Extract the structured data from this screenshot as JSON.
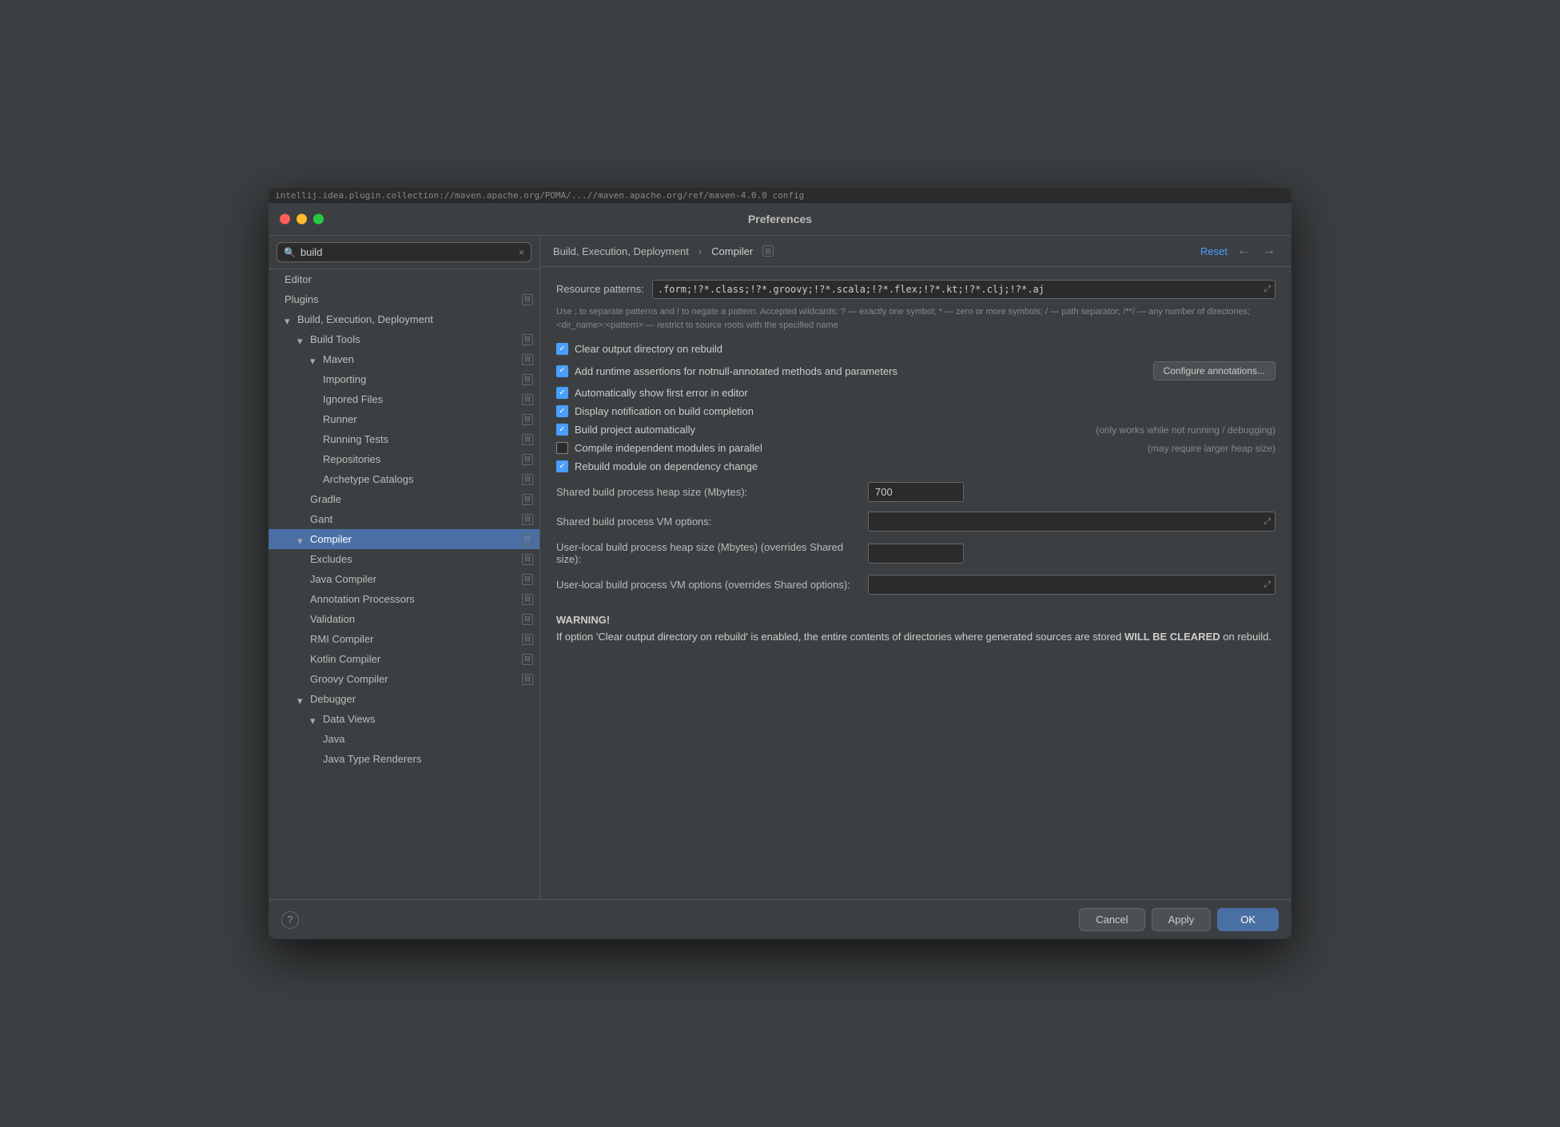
{
  "dialog": {
    "title": "Preferences",
    "url_bar": "intellij.idea.plugin.collection://maven.apache.org/POMA/...//maven.apache.org/ref/maven-4.0.0 config"
  },
  "traffic_lights": {
    "close": "close",
    "minimize": "minimize",
    "maximize": "maximize"
  },
  "sidebar": {
    "search_placeholder": "build",
    "search_value": "build",
    "clear_icon": "×",
    "items": [
      {
        "id": "editor",
        "label": "Editor",
        "indent": 0,
        "arrow": null,
        "badge": false
      },
      {
        "id": "plugins",
        "label": "Plugins",
        "indent": 0,
        "arrow": null,
        "badge": true
      },
      {
        "id": "build-execution-deployment",
        "label": "Build, Execution, Deployment",
        "indent": 0,
        "arrow": "down",
        "badge": false
      },
      {
        "id": "build-tools",
        "label": "Build Tools",
        "indent": 1,
        "arrow": "down",
        "badge": true
      },
      {
        "id": "maven",
        "label": "Maven",
        "indent": 2,
        "arrow": "down",
        "badge": true
      },
      {
        "id": "importing",
        "label": "Importing",
        "indent": 3,
        "arrow": null,
        "badge": true
      },
      {
        "id": "ignored-files",
        "label": "Ignored Files",
        "indent": 3,
        "arrow": null,
        "badge": true
      },
      {
        "id": "runner",
        "label": "Runner",
        "indent": 3,
        "arrow": null,
        "badge": true
      },
      {
        "id": "running-tests",
        "label": "Running Tests",
        "indent": 3,
        "arrow": null,
        "badge": true
      },
      {
        "id": "repositories",
        "label": "Repositories",
        "indent": 3,
        "arrow": null,
        "badge": true
      },
      {
        "id": "archetype-catalogs",
        "label": "Archetype Catalogs",
        "indent": 3,
        "arrow": null,
        "badge": true
      },
      {
        "id": "gradle",
        "label": "Gradle",
        "indent": 2,
        "arrow": null,
        "badge": true
      },
      {
        "id": "gant",
        "label": "Gant",
        "indent": 2,
        "arrow": null,
        "badge": true
      },
      {
        "id": "compiler",
        "label": "Compiler",
        "indent": 1,
        "arrow": "down",
        "badge": true,
        "selected": true
      },
      {
        "id": "excludes",
        "label": "Excludes",
        "indent": 2,
        "arrow": null,
        "badge": true
      },
      {
        "id": "java-compiler",
        "label": "Java Compiler",
        "indent": 2,
        "arrow": null,
        "badge": true
      },
      {
        "id": "annotation-processors",
        "label": "Annotation Processors",
        "indent": 2,
        "arrow": null,
        "badge": true
      },
      {
        "id": "validation",
        "label": "Validation",
        "indent": 2,
        "arrow": null,
        "badge": true
      },
      {
        "id": "rmi-compiler",
        "label": "RMI Compiler",
        "indent": 2,
        "arrow": null,
        "badge": true
      },
      {
        "id": "kotlin-compiler",
        "label": "Kotlin Compiler",
        "indent": 2,
        "arrow": null,
        "badge": true
      },
      {
        "id": "groovy-compiler",
        "label": "Groovy Compiler",
        "indent": 2,
        "arrow": null,
        "badge": true
      },
      {
        "id": "debugger",
        "label": "Debugger",
        "indent": 1,
        "arrow": "down",
        "badge": false
      },
      {
        "id": "data-views",
        "label": "Data Views",
        "indent": 2,
        "arrow": "down",
        "badge": false
      },
      {
        "id": "java",
        "label": "Java",
        "indent": 3,
        "arrow": null,
        "badge": false
      },
      {
        "id": "java-type-renderers",
        "label": "Java Type Renderers",
        "indent": 3,
        "arrow": null,
        "badge": false
      }
    ]
  },
  "content": {
    "breadcrumb": "Build, Execution, Deployment",
    "breadcrumb_separator": "›",
    "breadcrumb_current": "Compiler",
    "reset_label": "Reset",
    "nav_back": "←",
    "nav_forward": "→",
    "resource_patterns_label": "Resource patterns:",
    "resource_patterns_value": ".form;!?*.class;!?*.groovy;!?*.scala;!?*.flex;!?*.kt;!?*.clj;!?*.aj",
    "hint_text": "Use ; to separate patterns and ! to negate a pattern. Accepted wildcards: ? — exactly one symbol; * — zero or more symbols; / — path separator; /**/ — any number of directories; <dir_name>:<pattern> — restrict to source roots with the specified name",
    "checkboxes": [
      {
        "id": "clear-output",
        "label": "Clear output directory on rebuild",
        "checked": true,
        "note": null,
        "configure_btn": null
      },
      {
        "id": "add-runtime-assertions",
        "label": "Add runtime assertions for notnull-annotated methods and parameters",
        "checked": true,
        "note": null,
        "configure_btn": "Configure annotations..."
      },
      {
        "id": "auto-show-first-error",
        "label": "Automatically show first error in editor",
        "checked": true,
        "note": null,
        "configure_btn": null
      },
      {
        "id": "display-notification",
        "label": "Display notification on build completion",
        "checked": true,
        "note": null,
        "configure_btn": null
      },
      {
        "id": "build-automatically",
        "label": "Build project automatically",
        "checked": true,
        "note": "(only works while not running / debugging)",
        "configure_btn": null
      },
      {
        "id": "compile-parallel",
        "label": "Compile independent modules in parallel",
        "checked": false,
        "note": "(may require larger heap size)",
        "configure_btn": null
      },
      {
        "id": "rebuild-on-dependency",
        "label": "Rebuild module on dependency change",
        "checked": true,
        "note": null,
        "configure_btn": null
      }
    ],
    "fields": [
      {
        "id": "shared-heap",
        "label": "Shared build process heap size (Mbytes):",
        "value": "700",
        "wide": false
      },
      {
        "id": "shared-vm",
        "label": "Shared build process VM options:",
        "value": "",
        "wide": true
      },
      {
        "id": "user-heap",
        "label": "User-local build process heap size (Mbytes) (overrides Shared size):",
        "value": "",
        "wide": false
      },
      {
        "id": "user-vm",
        "label": "User-local build process VM options (overrides Shared options):",
        "value": "",
        "wide": true
      }
    ],
    "warning_title": "WARNING!",
    "warning_body": "If option 'Clear output directory on rebuild' is enabled, the entire contents of directories where generated sources are stored WILL BE CLEARED on rebuild."
  },
  "footer": {
    "help_label": "?",
    "cancel_label": "Cancel",
    "apply_label": "Apply",
    "ok_label": "OK"
  }
}
